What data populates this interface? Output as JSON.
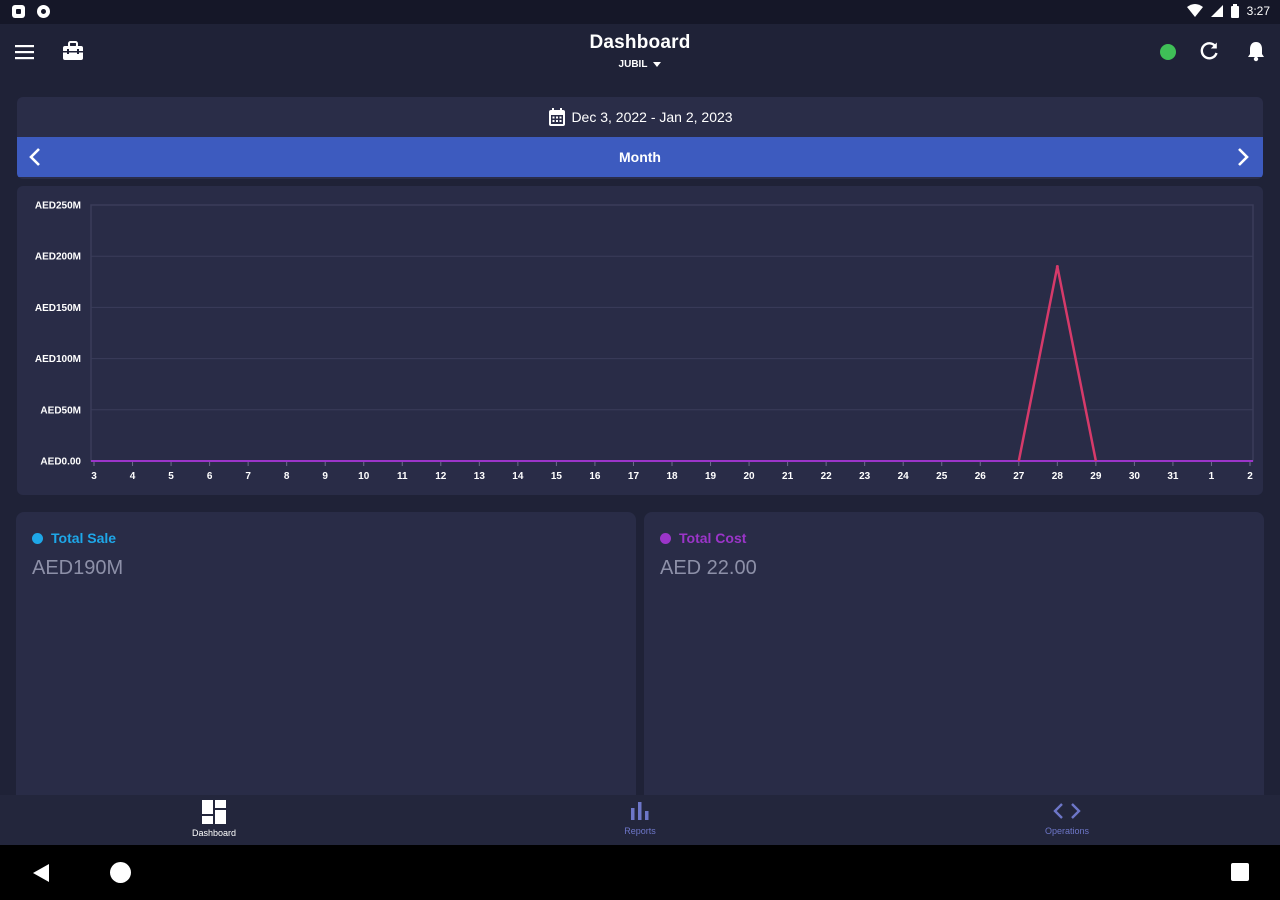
{
  "status_bar": {
    "time": "3:27"
  },
  "appbar": {
    "title": "Dashboard",
    "subtitle": "JUBIL"
  },
  "date_range": {
    "label": "Dec 3, 2022 - Jan 2, 2023"
  },
  "period": {
    "label": "Month"
  },
  "chart_data": {
    "type": "line",
    "title": "",
    "xlabel": "",
    "ylabel": "",
    "categories": [
      "3",
      "4",
      "5",
      "6",
      "7",
      "8",
      "9",
      "10",
      "11",
      "12",
      "13",
      "14",
      "15",
      "16",
      "17",
      "18",
      "19",
      "20",
      "21",
      "22",
      "23",
      "24",
      "25",
      "26",
      "27",
      "28",
      "29",
      "30",
      "31",
      "1",
      "2"
    ],
    "y_ticks": [
      "AED0.00",
      "AED50M",
      "AED100M",
      "AED150M",
      "AED200M",
      "AED250M"
    ],
    "ylim": [
      0,
      250000000
    ],
    "series": [
      {
        "color": "#d63a6a",
        "values": [
          0,
          0,
          0,
          0,
          0,
          0,
          0,
          0,
          0,
          0,
          0,
          0,
          0,
          0,
          0,
          0,
          0,
          0,
          0,
          0,
          0,
          0,
          0,
          0,
          0,
          190000000,
          0,
          0,
          0,
          0,
          0
        ]
      }
    ],
    "baseline_color": "#9b35c9",
    "grid": true
  },
  "stats": {
    "total_sale": {
      "label": "Total Sale",
      "value": "AED190M",
      "color": "#1ea7e8"
    },
    "total_cost": {
      "label": "Total Cost",
      "value": "AED 22.00",
      "color": "#9b35c9"
    }
  },
  "bottom_nav": {
    "dashboard": "Dashboard",
    "reports": "Reports",
    "operations": "Operations"
  }
}
